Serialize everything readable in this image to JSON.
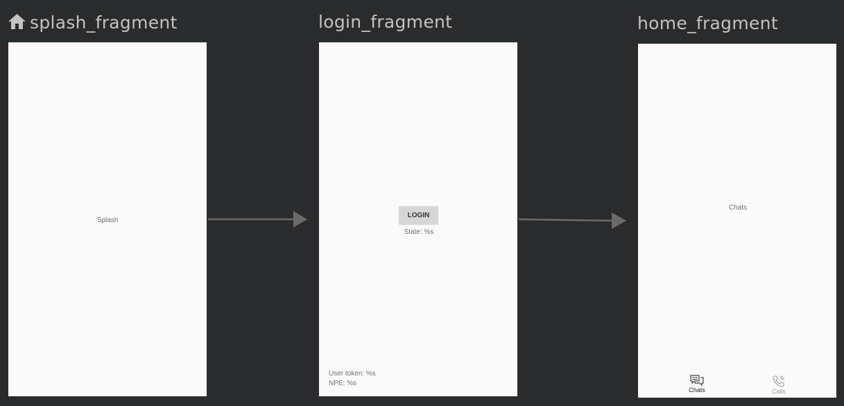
{
  "destinations": [
    {
      "id": "splash_fragment",
      "title": "splash_fragment",
      "is_start": true,
      "content": {
        "label": "Splash"
      }
    },
    {
      "id": "login_fragment",
      "title": "login_fragment",
      "content": {
        "button": "LOGIN",
        "state": "State: %s",
        "user_token": "User token: %s",
        "npe": "NPE: %s"
      }
    },
    {
      "id": "home_fragment",
      "title": "home_fragment",
      "content": {
        "label": "Chats",
        "bottom_nav": [
          {
            "label": "Chats",
            "icon": "chat-icon",
            "selected": true
          },
          {
            "label": "Calls",
            "icon": "phone-icon",
            "selected": false
          }
        ]
      }
    }
  ],
  "actions": [
    {
      "from": "splash_fragment",
      "to": "login_fragment"
    },
    {
      "from": "login_fragment",
      "to": "home_fragment"
    }
  ],
  "colors": {
    "background": "#2a2b2d",
    "screen": "#fafafa",
    "title": "#c3c3c3",
    "arrow": "#6a6a6a"
  }
}
